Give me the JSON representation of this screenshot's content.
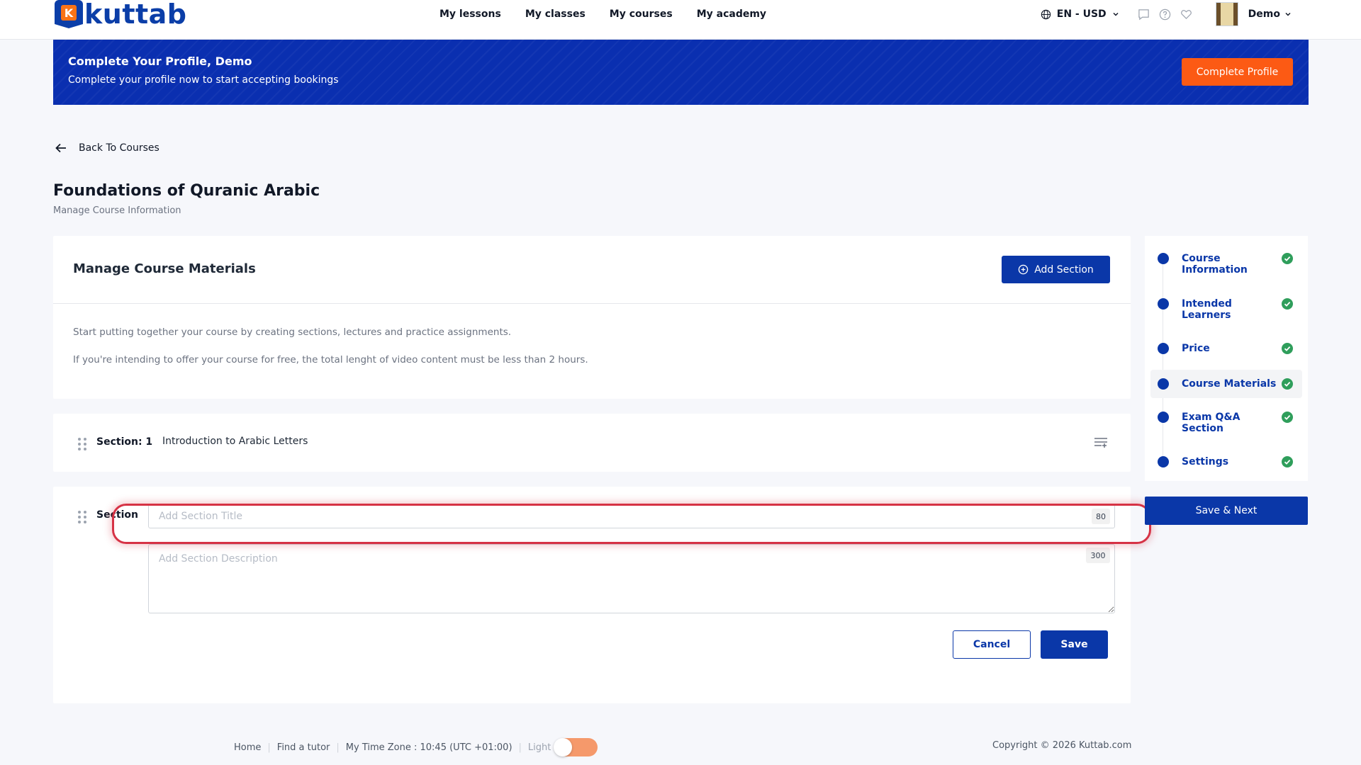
{
  "header": {
    "logo_text": "kuttab",
    "logo_letter": "K",
    "nav": [
      "My lessons",
      "My classes",
      "My courses",
      "My academy"
    ],
    "language_currency": "EN - USD",
    "user_name": "Demo"
  },
  "banner": {
    "title": "Complete Your Profile, Demo",
    "subtitle": "Complete your profile now to start accepting bookings",
    "button": "Complete Profile"
  },
  "back_link": "Back To Courses",
  "page": {
    "title": "Foundations of Quranic Arabic",
    "subtitle": "Manage Course Information"
  },
  "materials": {
    "title": "Manage Course Materials",
    "add_section_button": "Add Section",
    "info": [
      "Start putting together your course by creating sections, lectures and practice assignments.",
      "If you're intending to offer your course for free, the total lenght of video content must be less than 2 hours."
    ]
  },
  "sections": [
    {
      "label": "Section: 1",
      "title": "Introduction to Arabic Letters"
    }
  ],
  "new_section": {
    "label": "Section",
    "title_placeholder": "Add Section Title",
    "title_value": "",
    "title_max": "80",
    "description_placeholder": "Add Section Description",
    "description_value": "",
    "description_max": "300",
    "cancel_button": "Cancel",
    "save_button": "Save"
  },
  "steps": [
    {
      "label": "Course Information",
      "done": true
    },
    {
      "label": "Intended Learners",
      "done": true
    },
    {
      "label": "Price",
      "done": true
    },
    {
      "label": "Course Materials",
      "done": true,
      "active": true
    },
    {
      "label": "Exam Q&A Section",
      "done": true
    },
    {
      "label": "Settings",
      "done": true
    }
  ],
  "save_next_button": "Save & Next",
  "footer": {
    "links": [
      "Home",
      "Find a tutor"
    ],
    "timezone": "My Time Zone : 10:45 (UTC +01:00)",
    "theme_label": "Light",
    "copyright": "Copyright © 2026 Kuttab.com"
  },
  "colors": {
    "primary": "#0a37a8",
    "banner": "#0a2fb0",
    "accent_orange": "#fc5a14",
    "success": "#2f9e5b",
    "highlight": "#d63245"
  }
}
